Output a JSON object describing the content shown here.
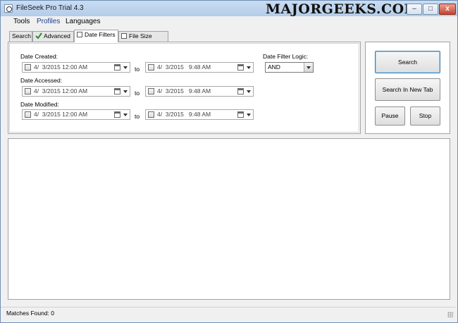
{
  "window": {
    "title": "FileSeek Pro Trial 4.3",
    "watermark": "MAJORGEEKS.COM",
    "minimize": "–",
    "maximize": "□",
    "close": "x"
  },
  "menu": [
    "Tools",
    "Profiles",
    "Languages"
  ],
  "tabs": [
    {
      "label": "Search"
    },
    {
      "label": "Advanced"
    },
    {
      "label": "Date Filters"
    },
    {
      "label": "File Size Filters"
    }
  ],
  "date_filters": {
    "created": {
      "label": "Date Created:",
      "from": "4/  3/2015 12:00 AM",
      "to": "4/  3/2015   9:48 AM"
    },
    "accessed": {
      "label": "Date Accessed:",
      "from": "4/  3/2015 12:00 AM",
      "to": "4/  3/2015   9:48 AM"
    },
    "modified": {
      "label": "Date Modified:",
      "from": "4/  3/2015 12:00 AM",
      "to": "4/  3/2015   9:48 AM"
    },
    "to_label": "to",
    "logic_label": "Date Filter Logic:",
    "logic_value": "AND"
  },
  "buttons": {
    "search": "Search",
    "search_new_tab": "Search In New Tab",
    "pause": "Pause",
    "stop": "Stop"
  },
  "status": {
    "matches": "Matches Found: 0"
  }
}
